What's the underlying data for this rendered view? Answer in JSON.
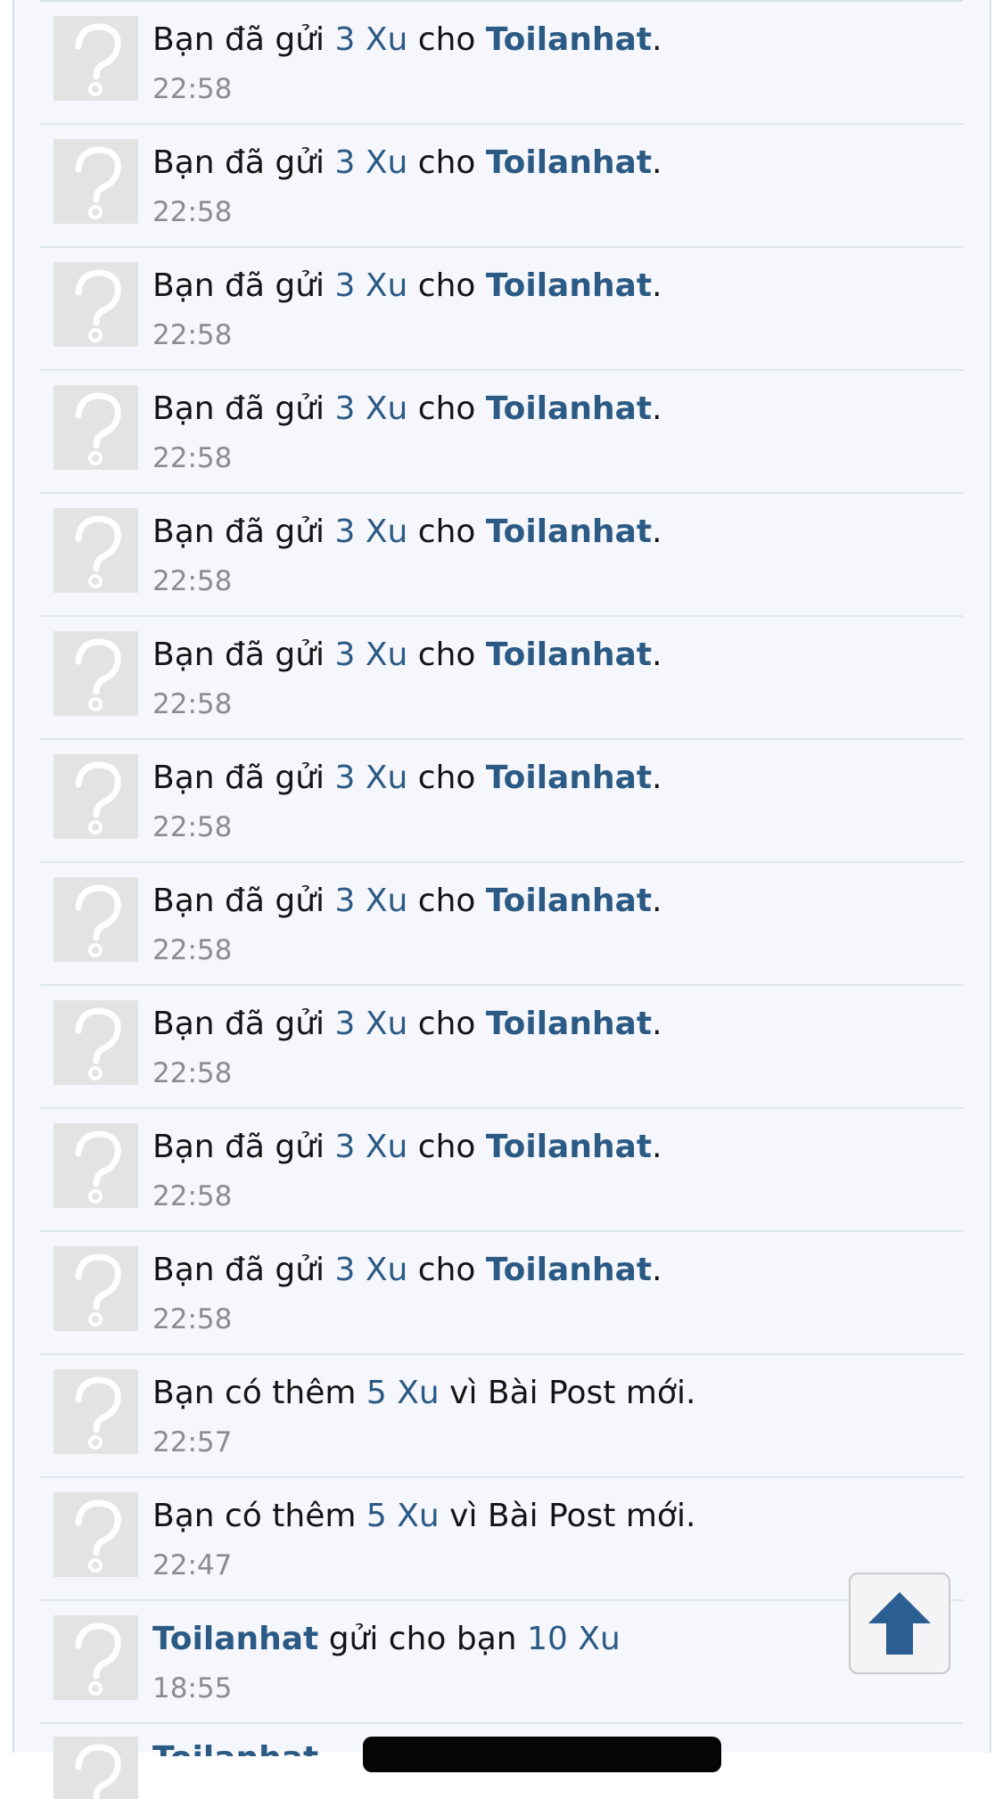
{
  "feed": {
    "items": [
      {
        "type": "sent",
        "prefix": "Bạn đã gửi ",
        "amount": "3 Xu",
        "mid": " cho ",
        "user": "Toilanhat",
        "suffix": ".",
        "time": "22:58"
      },
      {
        "type": "sent",
        "prefix": "Bạn đã gửi ",
        "amount": "3 Xu",
        "mid": " cho ",
        "user": "Toilanhat",
        "suffix": ".",
        "time": "22:58"
      },
      {
        "type": "sent",
        "prefix": "Bạn đã gửi ",
        "amount": "3 Xu",
        "mid": " cho ",
        "user": "Toilanhat",
        "suffix": ".",
        "time": "22:58"
      },
      {
        "type": "sent",
        "prefix": "Bạn đã gửi ",
        "amount": "3 Xu",
        "mid": " cho ",
        "user": "Toilanhat",
        "suffix": ".",
        "time": "22:58"
      },
      {
        "type": "sent",
        "prefix": "Bạn đã gửi ",
        "amount": "3 Xu",
        "mid": " cho ",
        "user": "Toilanhat",
        "suffix": ".",
        "time": "22:58"
      },
      {
        "type": "sent",
        "prefix": "Bạn đã gửi ",
        "amount": "3 Xu",
        "mid": " cho ",
        "user": "Toilanhat",
        "suffix": ".",
        "time": "22:58"
      },
      {
        "type": "sent",
        "prefix": "Bạn đã gửi ",
        "amount": "3 Xu",
        "mid": " cho ",
        "user": "Toilanhat",
        "suffix": ".",
        "time": "22:58"
      },
      {
        "type": "sent",
        "prefix": "Bạn đã gửi ",
        "amount": "3 Xu",
        "mid": " cho ",
        "user": "Toilanhat",
        "suffix": ".",
        "time": "22:58"
      },
      {
        "type": "sent",
        "prefix": "Bạn đã gửi ",
        "amount": "3 Xu",
        "mid": " cho ",
        "user": "Toilanhat",
        "suffix": ".",
        "time": "22:58"
      },
      {
        "type": "sent",
        "prefix": "Bạn đã gửi ",
        "amount": "3 Xu",
        "mid": " cho ",
        "user": "Toilanhat",
        "suffix": ".",
        "time": "22:58"
      },
      {
        "type": "sent",
        "prefix": "Bạn đã gửi ",
        "amount": "3 Xu",
        "mid": " cho ",
        "user": "Toilanhat",
        "suffix": ".",
        "time": "22:58"
      },
      {
        "type": "earned",
        "prefix": "Bạn có thêm ",
        "amount": "5 Xu",
        "suffix": " vì Bài Post mới.",
        "time": "22:57"
      },
      {
        "type": "earned",
        "prefix": "Bạn có thêm ",
        "amount": "5 Xu",
        "suffix": " vì Bài Post mới.",
        "time": "22:47"
      },
      {
        "type": "received",
        "user": "Toilanhat",
        "mid": " gửi cho bạn ",
        "amount": "10 Xu",
        "time": "18:55"
      },
      {
        "type": "partial",
        "user": "Toilanhat"
      }
    ]
  },
  "scroll_top": {
    "icon": "arrow-up-icon"
  },
  "colors": {
    "link": "#2b5a85",
    "time": "#8c8c8c",
    "background": "#f6f7fc"
  }
}
